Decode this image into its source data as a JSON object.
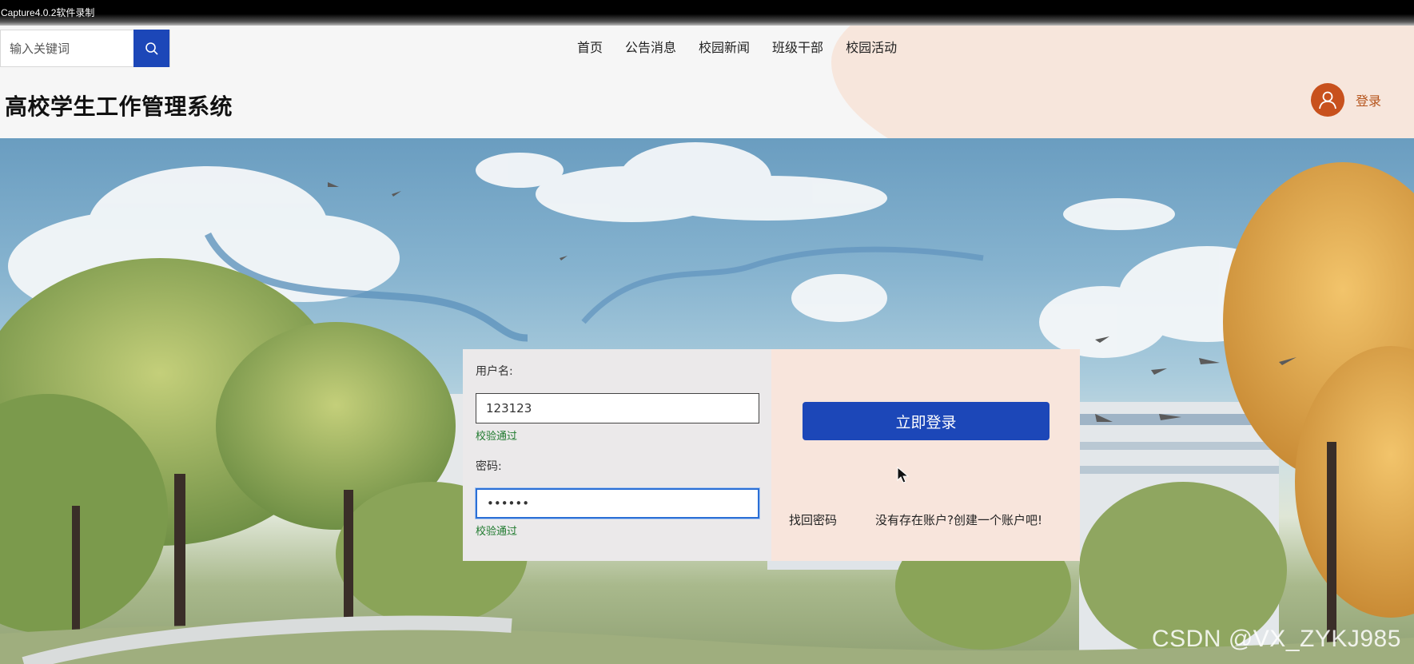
{
  "recorder": {
    "title": "Capture4.0.2软件录制"
  },
  "header": {
    "search": {
      "placeholder": "输入关键词"
    },
    "nav": [
      "首页",
      "公告消息",
      "校园新闻",
      "班级干部",
      "校园活动"
    ],
    "site_title": "高校学生工作管理系统",
    "login_label": "登录"
  },
  "login": {
    "username_label": "用户名:",
    "username_value": "123123",
    "username_status": "校验通过",
    "password_label": "密码:",
    "password_value": "••••••",
    "password_status": "校验通过",
    "submit_label": "立即登录",
    "forgot_label": "找回密码",
    "register_label": "没有存在账户?创建一个账户吧!"
  },
  "watermark": "CSDN @VX_ZYKJ985",
  "colors": {
    "brand_blue": "#1c47b8",
    "accent_orange": "#c8511d",
    "valid_green": "#1f7a2e",
    "panel_peach": "#f8e5dc"
  }
}
